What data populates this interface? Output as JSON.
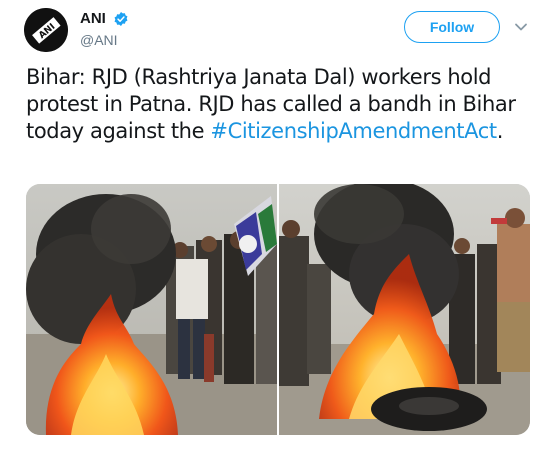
{
  "tweet": {
    "author": {
      "display_name": "ANI",
      "handle": "@ANI",
      "verified": true,
      "avatar_text": "ANI",
      "avatar_icon": "ani-logo"
    },
    "follow_label": "Follow",
    "menu_icon": "chevron-down-icon",
    "text_before_hashtag": "Bihar: RJD (Rashtriya Janata Dal) workers hold protest in Patna. RJD has called a bandh in Bihar today against the ",
    "hashtag": "#CitizenshipAmendmentAct",
    "text_after_hashtag": ".",
    "media": [
      {
        "kind": "photo",
        "icon": "protest-fire-photo"
      },
      {
        "kind": "photo",
        "icon": "burning-tyre-photo"
      }
    ]
  },
  "colors": {
    "brand_blue": "#1da1f2",
    "hashtag_blue": "#1b95e0",
    "text": "#14171a",
    "muted": "#657786"
  }
}
